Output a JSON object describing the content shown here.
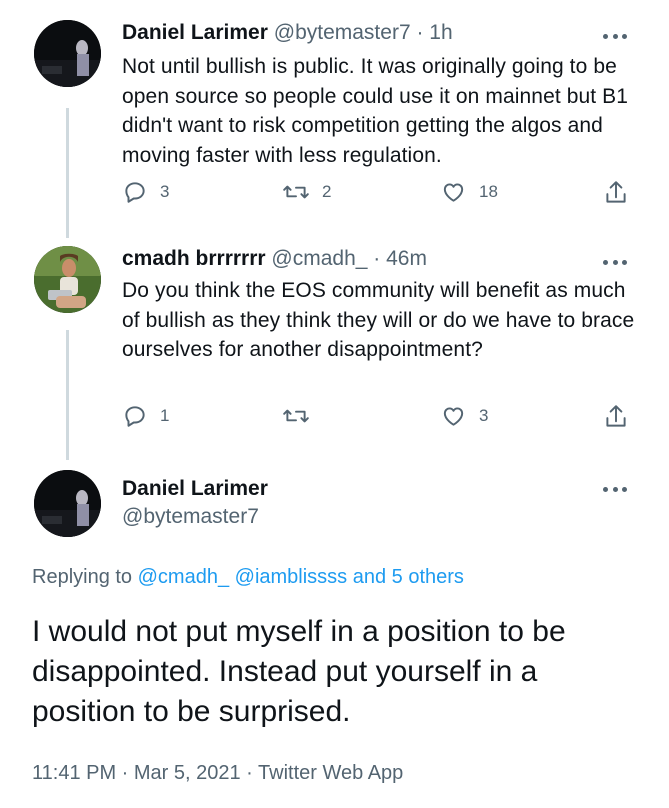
{
  "colors": {
    "text": "#0f1419",
    "secondary": "#536471",
    "link": "#1d9bf0",
    "thread_line": "#cfd9de"
  },
  "tweets": [
    {
      "name": "Daniel Larimer",
      "meta": "@bytemaster7 · 1h",
      "text": "Not until bullish is public. It was originally going to be open source so people could use it on mainnet but B1 didn't want to risk competition getting the algos and moving faster with less regulation.",
      "replies": "3",
      "retweets": "2",
      "likes": "18"
    },
    {
      "name": "cmadh brrrrrrr",
      "meta": "@cmadh_ · 46m",
      "text": "Do you think the EOS community will benefit as much of bullish as they think they will or do we have to brace ourselves for another disappointment?",
      "replies": "1",
      "retweets": "",
      "likes": "3"
    }
  ],
  "main": {
    "name": "Daniel Larimer",
    "handle": "@bytemaster7",
    "replying_prefix": "Replying to",
    "replying_to": "@cmadh_ @iamblissss and 5 others",
    "text": "I would not put myself in a position to be disappointed. Instead put yourself in a position to be surprised.",
    "timestamp": "11:41 PM · Mar 5, 2021 · Twitter Web App"
  },
  "icons": [
    "reply-icon",
    "retweet-icon",
    "like-icon",
    "share-icon",
    "more-icon"
  ]
}
